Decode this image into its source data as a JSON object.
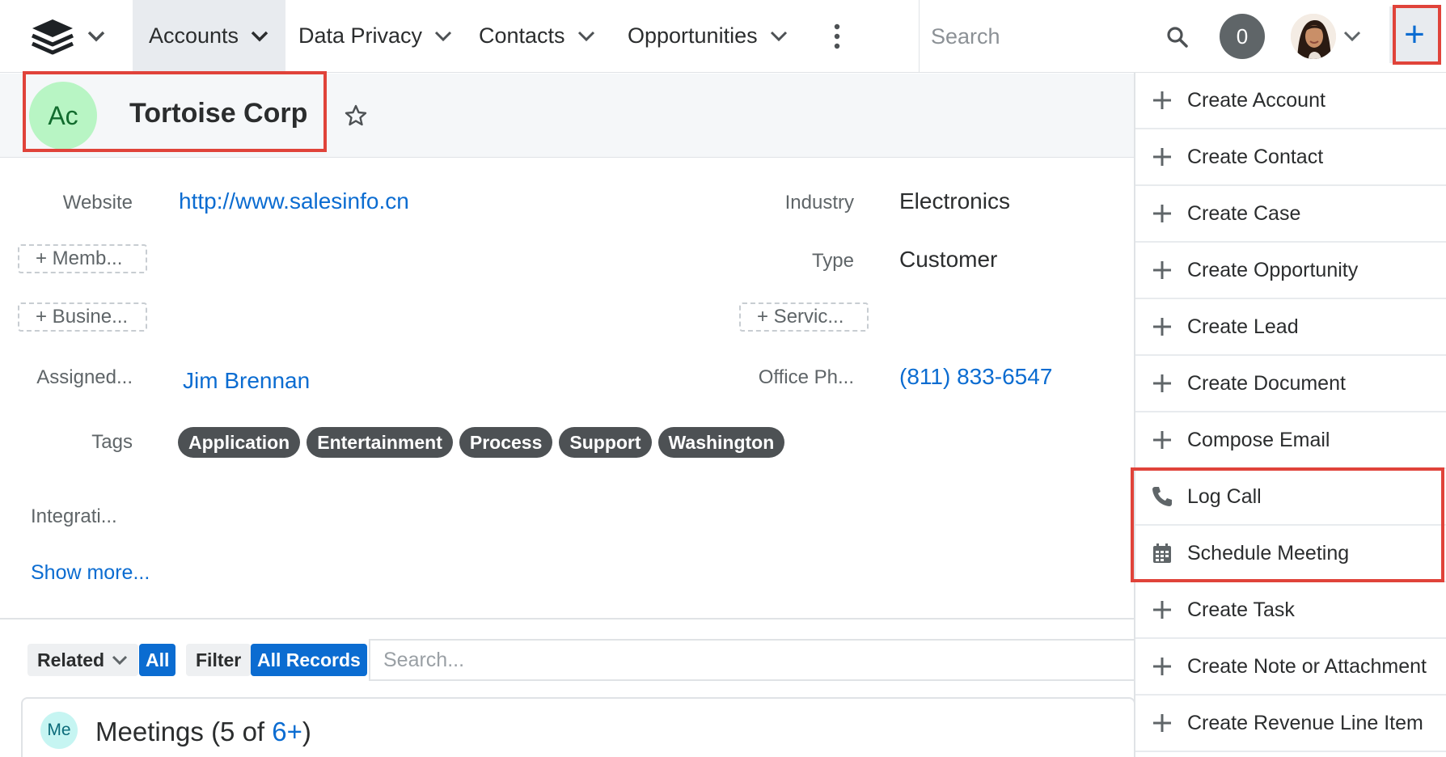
{
  "nav": {
    "tabs": [
      {
        "label": "Accounts"
      },
      {
        "label": "Data Privacy"
      },
      {
        "label": "Contacts"
      },
      {
        "label": "Opportunities"
      }
    ],
    "search_placeholder": "Search",
    "notification_count": "0",
    "quick_create_label": "+"
  },
  "record": {
    "avatar_initials": "Ac",
    "name": "Tortoise Corp"
  },
  "fields": {
    "website_label": "Website",
    "website_value": "http://www.salesinfo.cn",
    "industry_label": "Industry",
    "industry_value": "Electronics",
    "member_button": "+ Memb...",
    "type_label": "Type",
    "type_value": "Customer",
    "business_button": "+ Busine...",
    "service_button": "+ Servic...",
    "assigned_label": "Assigned...",
    "assigned_value": "Jim Brennan",
    "office_phone_label": "Office Ph...",
    "office_phone_value": "(811) 833-6547",
    "tags_label": "Tags",
    "tags": [
      "Application",
      "Entertainment",
      "Process",
      "Support",
      "Washington"
    ],
    "integration_label": "Integrati...",
    "show_more": "Show more..."
  },
  "subpanel": {
    "related_label": "Related",
    "all_label": "All",
    "filter_label": "Filter",
    "all_records_label": "All Records",
    "search_placeholder": "Search...",
    "meetings_icon": "Me",
    "meetings_title": "Meetings (5 of ",
    "meetings_count_link": "6+",
    "meetings_close": ")"
  },
  "dropdown": {
    "items": [
      {
        "label": "Create Account",
        "icon": "plus-icon"
      },
      {
        "label": "Create Contact",
        "icon": "plus-icon"
      },
      {
        "label": "Create Case",
        "icon": "plus-icon"
      },
      {
        "label": "Create Opportunity",
        "icon": "plus-icon"
      },
      {
        "label": "Create Lead",
        "icon": "plus-icon"
      },
      {
        "label": "Create Document",
        "icon": "plus-icon"
      },
      {
        "label": "Compose Email",
        "icon": "plus-icon"
      },
      {
        "label": "Log Call",
        "icon": "phone-icon"
      },
      {
        "label": "Schedule Meeting",
        "icon": "calendar-icon"
      },
      {
        "label": "Create Task",
        "icon": "plus-icon"
      },
      {
        "label": "Create Note or Attachment",
        "icon": "plus-icon"
      },
      {
        "label": "Create Revenue Line Item",
        "icon": "plus-icon"
      }
    ]
  },
  "colors": {
    "accent": "#0b6cd1",
    "highlight": "#e0433a",
    "avatar_green": "#b8f5c4",
    "tag_dark": "#4d5154"
  }
}
